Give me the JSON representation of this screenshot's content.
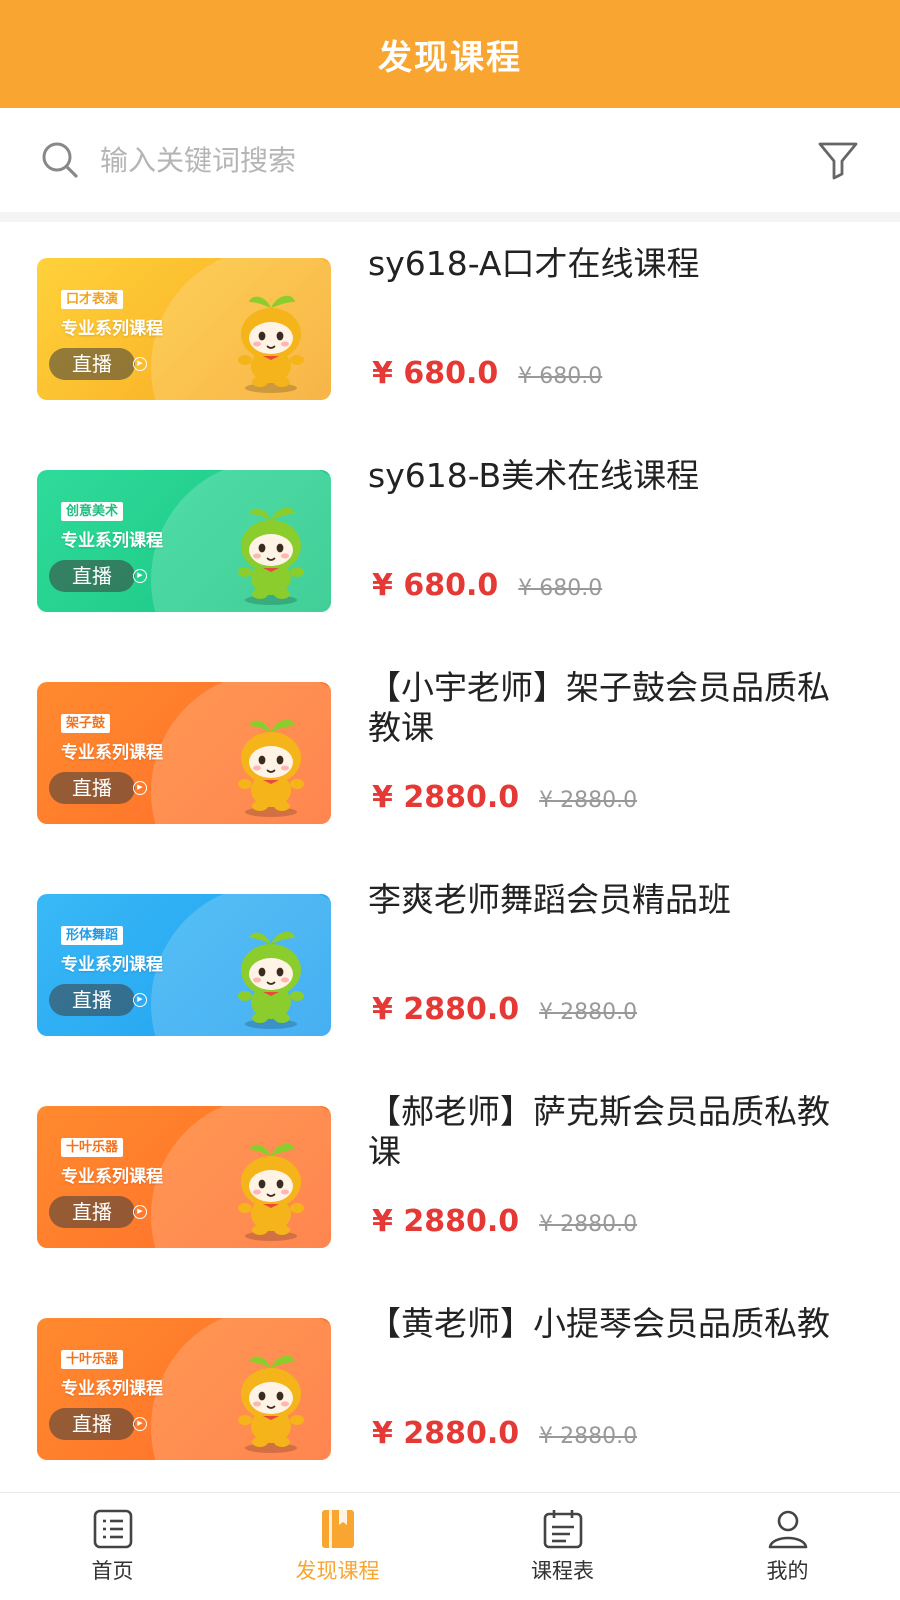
{
  "header": {
    "title": "发现课程"
  },
  "search": {
    "placeholder": "输入关键词搜索",
    "icon": "search-icon",
    "filter_icon": "filter-icon"
  },
  "courses": [
    {
      "title": "sy618-A口才在线课程",
      "price": "¥ 680.0",
      "original_price": "¥ 680.0",
      "thumb": {
        "tag": "口才表演",
        "subtitle": "专业系列课程",
        "live": "直播",
        "bg_from": "#FFD23A",
        "bg_to": "#F7A520",
        "tag_color": "#F3A21E"
      }
    },
    {
      "title": "sy618-B美术在线课程",
      "price": "¥ 680.0",
      "original_price": "¥ 680.0",
      "thumb": {
        "tag": "创意美术",
        "subtitle": "专业系列课程",
        "live": "直播",
        "bg_from": "#2FDB9A",
        "bg_to": "#19C481",
        "tag_color": "#1DBF80"
      }
    },
    {
      "title": "【小宇老师】架子鼓会员品质私教课",
      "price": "¥ 2880.0",
      "original_price": "¥ 2880.0",
      "thumb": {
        "tag": "架子鼓",
        "subtitle": "专业系列课程",
        "live": "直播",
        "bg_from": "#FF8A2E",
        "bg_to": "#FF6B2A",
        "tag_color": "#F0741F"
      }
    },
    {
      "title": "李爽老师舞蹈会员精品班",
      "price": "¥ 2880.0",
      "original_price": "¥ 2880.0",
      "thumb": {
        "tag": "形体舞蹈",
        "subtitle": "专业系列课程",
        "live": "直播",
        "bg_from": "#39B9F6",
        "bg_to": "#1E9EEF",
        "tag_color": "#1E9BE8"
      }
    },
    {
      "title": "【郝老师】萨克斯会员品质私教课",
      "price": "¥ 2880.0",
      "original_price": "¥ 2880.0",
      "thumb": {
        "tag": "十叶乐器",
        "subtitle": "专业系列课程",
        "live": "直播",
        "bg_from": "#FF8A2E",
        "bg_to": "#FF6B2A",
        "tag_color": "#F0741F"
      }
    },
    {
      "title": "【黄老师】小提琴会员品质私教",
      "price": "¥ 2880.0",
      "original_price": "¥ 2880.0",
      "thumb": {
        "tag": "十叶乐器",
        "subtitle": "专业系列课程",
        "live": "直播",
        "bg_from": "#FF8A2E",
        "bg_to": "#FF6B2A",
        "tag_color": "#F0741F"
      }
    }
  ],
  "nav": [
    {
      "label": "首页",
      "icon": "home-list-icon",
      "active": false
    },
    {
      "label": "发现课程",
      "icon": "book-icon",
      "active": true
    },
    {
      "label": "课程表",
      "icon": "calendar-icon",
      "active": false
    },
    {
      "label": "我的",
      "icon": "user-icon",
      "active": false
    }
  ],
  "colors": {
    "accent": "#F9A531",
    "price": "#E53935",
    "mascot_orange": "#F4B41A",
    "mascot_green": "#8ACD2C"
  }
}
